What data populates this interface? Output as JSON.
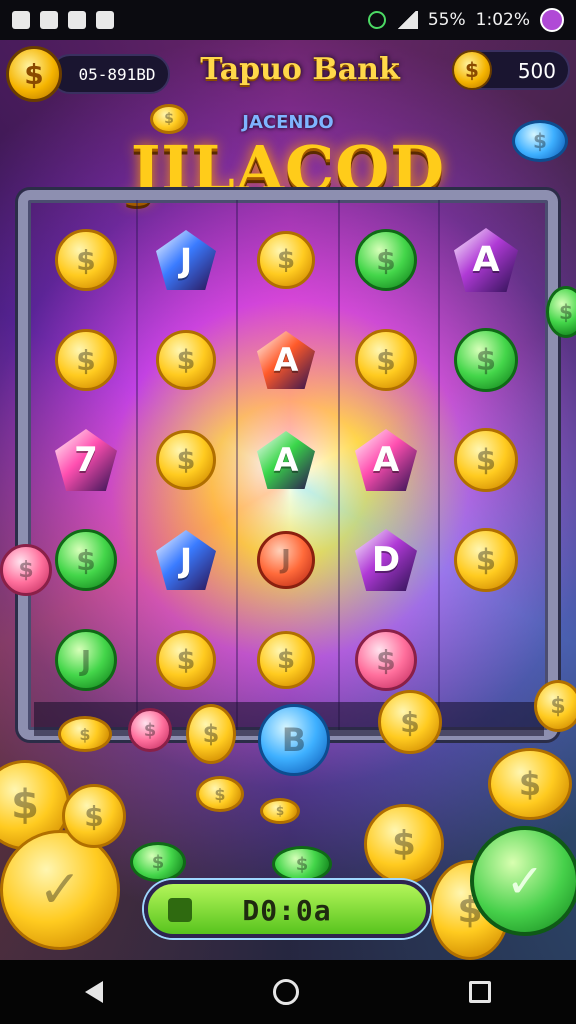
{
  "status_bar": {
    "battery": "55%",
    "time": "1:02%"
  },
  "hud": {
    "balance": "05-891BD",
    "title": "Tapuo Bank",
    "coins": "500",
    "coin_glyph": "$"
  },
  "banner": {
    "subtitle": "JACENDO",
    "logo": "JILACOD"
  },
  "reel_symbols": [
    {
      "glyph": "$",
      "kind": "gold"
    },
    {
      "glyph": "J",
      "kind": "gem-blue"
    },
    {
      "glyph": "$",
      "kind": "gold"
    },
    {
      "glyph": "$",
      "kind": "green"
    },
    {
      "glyph": "A",
      "kind": "gem-purple"
    },
    {
      "glyph": "$",
      "kind": "gold"
    },
    {
      "glyph": "$",
      "kind": "gold"
    },
    {
      "glyph": "A",
      "kind": "gem-red"
    },
    {
      "glyph": "$",
      "kind": "gold"
    },
    {
      "glyph": "$",
      "kind": "green"
    },
    {
      "glyph": "7",
      "kind": "gem-pink"
    },
    {
      "glyph": "$",
      "kind": "gold"
    },
    {
      "glyph": "A",
      "kind": "gem-green"
    },
    {
      "glyph": "A",
      "kind": "gem-pink"
    },
    {
      "glyph": "$",
      "kind": "gold"
    },
    {
      "glyph": "$",
      "kind": "green"
    },
    {
      "glyph": "J",
      "kind": "gem-blue"
    },
    {
      "glyph": "J",
      "kind": "red"
    },
    {
      "glyph": "D",
      "kind": "gem-purple"
    },
    {
      "glyph": "$",
      "kind": "gold"
    },
    {
      "glyph": "J",
      "kind": "green"
    },
    {
      "glyph": "$",
      "kind": "gold"
    },
    {
      "glyph": "$",
      "kind": "gold"
    },
    {
      "glyph": "$",
      "kind": "pink"
    }
  ],
  "bottom": {
    "spin_bar_text": "D0:0a",
    "spin_glyph": "✓"
  },
  "colors": {
    "gold": "#ffcb20",
    "green": "#44d64a",
    "accent_purple": "#c040e0"
  }
}
